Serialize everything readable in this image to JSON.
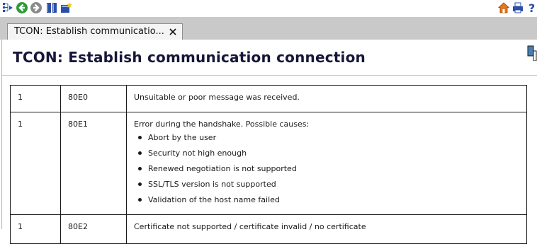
{
  "toolbar": {
    "icons": [
      "tree-sync-icon",
      "back-icon",
      "forward-icon",
      "bookmarks-icon",
      "new-bookmark-icon",
      "home-icon",
      "print-icon",
      "help-icon"
    ],
    "help_label": "?"
  },
  "tab": {
    "label": "TCON: Establish communicatio...",
    "close": "✕"
  },
  "page": {
    "title": "TCON: Establish communication connection"
  },
  "table": {
    "rows": [
      {
        "c1": "1",
        "c2": "80E0",
        "desc": "Unsuitable or poor message was received."
      },
      {
        "c1": "1",
        "c2": "80E1",
        "desc": "Error during the handshake. Possible causes:",
        "bullets": [
          "Abort by the user",
          "Security not high enough",
          "Renewed negotiation is not supported",
          "SSL/TLS version is not supported",
          "Validation of the host name failed"
        ]
      },
      {
        "c1": "1",
        "c2": "80E2",
        "desc": "Certificate not supported / certificate invalid / no certificate"
      }
    ]
  },
  "colors": {
    "title": "#16163a",
    "tabstrip": "#c9c9c9",
    "nav_green": "#2e9b3a",
    "nav_gray": "#8a8a8a",
    "home_orange": "#e07a1f",
    "print_blue": "#2a4fa8"
  }
}
